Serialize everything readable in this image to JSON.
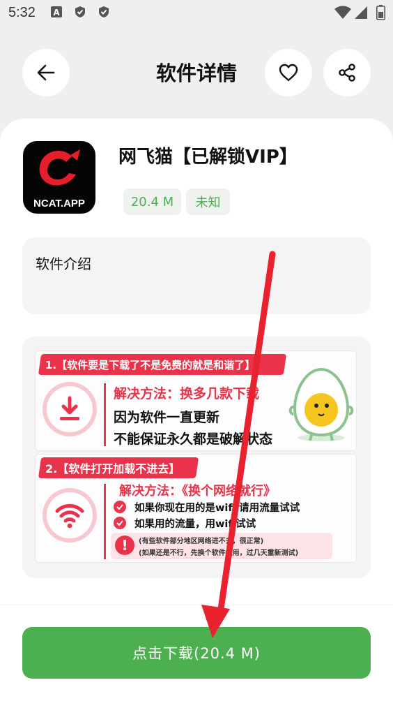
{
  "status_bar": {
    "time": "5:32",
    "icons": [
      "text-a-icon",
      "shield-check-icon",
      "shield-check-icon"
    ],
    "right_icons": [
      "wifi-icon",
      "signal-icon",
      "battery-icon"
    ]
  },
  "header": {
    "title": "软件详情",
    "back_icon": "arrow-left-icon",
    "favorite_icon": "heart-icon",
    "share_icon": "share-icon"
  },
  "app": {
    "name": "网飞猫【已解锁VIP】",
    "icon_text": "NCAT.APP",
    "size_tag": "20.4 M",
    "version_tag": "未知"
  },
  "intro": {
    "title": "软件介绍"
  },
  "help_image": {
    "issue1_title": "1.【软件要是下载了不是免费的就是和谐了】",
    "issue1_solution": "解决方法：换多几款下载",
    "issue1_line1": "因为软件一直更新",
    "issue1_line2": "不能保证永久都是破解状态",
    "issue2_title": "2.【软件打开加载不进去】",
    "issue2_solution": "解决方法：《换个网络就行》",
    "issue2_check1": "如果你现在用的是wifi 请用流量试试",
    "issue2_check2": "如果用的流量，用wifi试试",
    "issue2_note1": "(有些软件部分地区网络进不去，很正常)",
    "issue2_note2": "(如果还是不行，先换个软件使用，过几天重新测试)"
  },
  "download": {
    "label": "点击下载(20.4 M)"
  },
  "colors": {
    "accent_green": "#4caf50",
    "banner_red": "#e8334a",
    "arrow_red": "#e8222f"
  }
}
